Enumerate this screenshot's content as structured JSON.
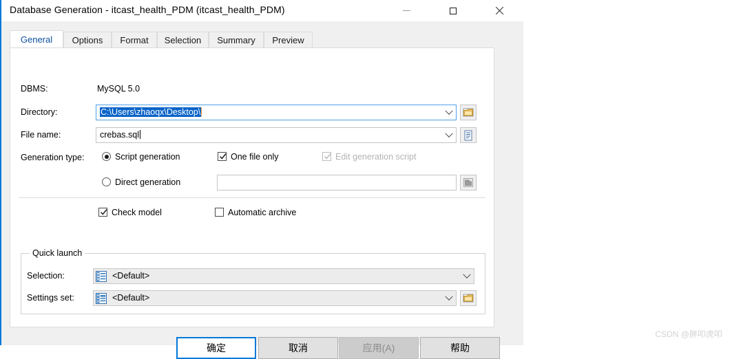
{
  "window": {
    "title": "Database Generation - itcast_health_PDM (itcast_health_PDM)",
    "controls": {
      "minimize": "minimize-icon",
      "maximize": "maximize-icon",
      "close": "close-icon"
    }
  },
  "tabs": [
    {
      "label": "General",
      "active": true
    },
    {
      "label": "Options",
      "active": false
    },
    {
      "label": "Format",
      "active": false
    },
    {
      "label": "Selection",
      "active": false
    },
    {
      "label": "Summary",
      "active": false
    },
    {
      "label": "Preview",
      "active": false
    }
  ],
  "general": {
    "dbms_label": "DBMS:",
    "dbms_value": "MySQL 5.0",
    "directory_label": "Directory:",
    "directory_value": "C:\\Users\\zhaoqx\\Desktop\\",
    "directory_browse_icon": "folder-icon",
    "filename_label": "File name:",
    "filename_value": "crebas.sql",
    "filename_browse_icon": "document-icon",
    "generation_type_label": "Generation type:",
    "script_generation_label": "Script generation",
    "script_generation_checked": true,
    "direct_generation_label": "Direct generation",
    "direct_generation_checked": false,
    "one_file_only_label": "One file only",
    "one_file_only_checked": true,
    "edit_generation_script_label": "Edit generation script",
    "edit_generation_script_checked": true,
    "edit_generation_script_enabled": false,
    "direct_generation_value": "",
    "direct_generation_browse_icon": "database-icon",
    "check_model_label": "Check model",
    "check_model_checked": true,
    "automatic_archive_label": "Automatic archive",
    "automatic_archive_checked": false
  },
  "quick_launch": {
    "group_title": "Quick launch",
    "selection_label": "Selection:",
    "selection_value": "<Default>",
    "selection_icon": "list-selection-icon",
    "settings_label": "Settings set:",
    "settings_value": "<Default>",
    "settings_icon": "list-settings-icon",
    "settings_browse_icon": "folder-icon"
  },
  "buttons": {
    "ok": "确定",
    "cancel": "取消",
    "apply": "应用(A)",
    "apply_enabled": false,
    "help": "帮助"
  },
  "watermark": "CSDN @胖叩虎叩",
  "colors": {
    "accent": "#0078d7",
    "selection": "#0a64c8",
    "tab_active_text": "#0b4f9e",
    "window_bg": "#f0f0f0",
    "panel_bg": "#ffffff"
  }
}
